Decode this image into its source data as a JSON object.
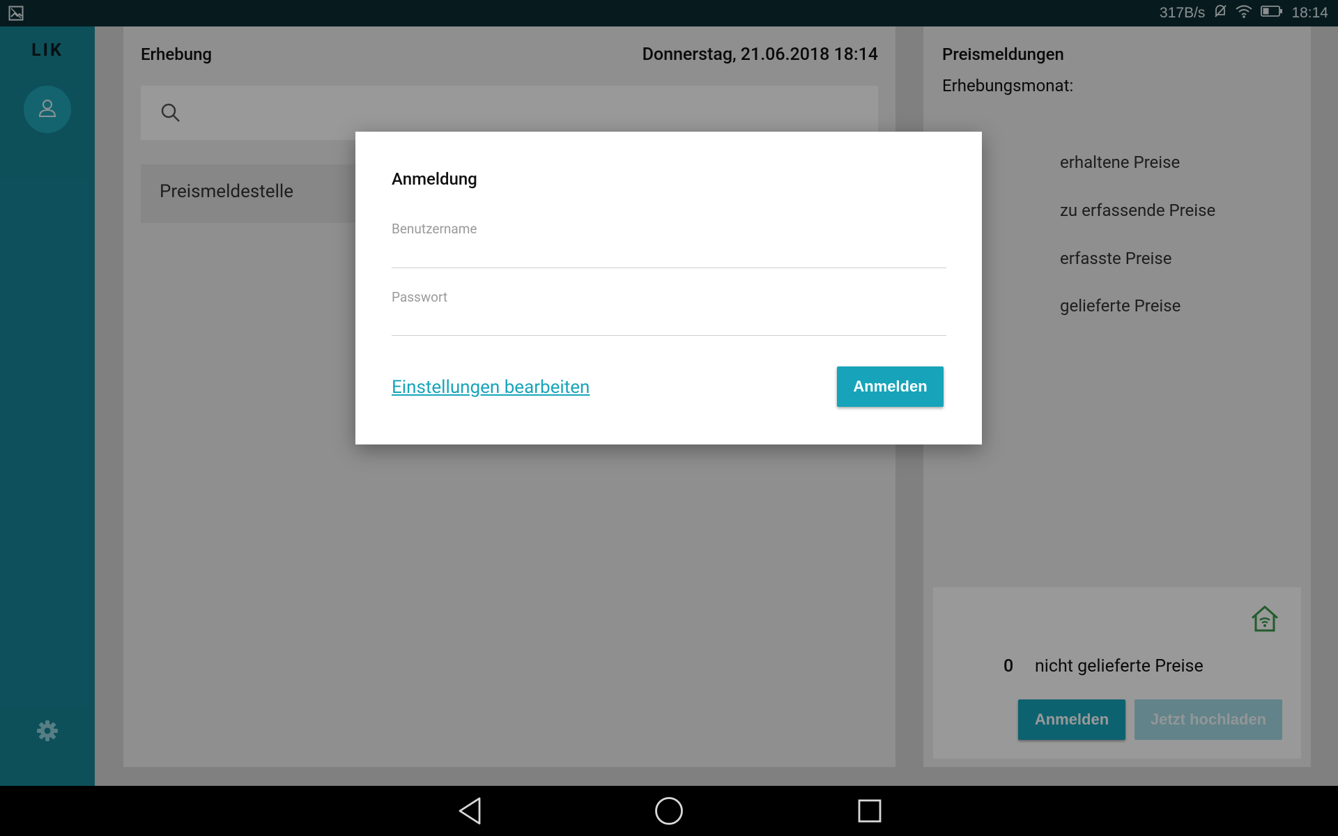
{
  "status_bar": {
    "network_speed": "317B/s",
    "time": "18:14",
    "icons": [
      "gallery-icon",
      "mute-icon",
      "wifi-icon",
      "battery-icon"
    ]
  },
  "sidebar": {
    "logo": "LIK",
    "icons": [
      "user-icon",
      "gear-icon"
    ]
  },
  "erhebung": {
    "title": "Erhebung",
    "datetime": "Donnerstag, 21.06.2018 18:14",
    "search_value": "",
    "list_item": "Preismeldestelle"
  },
  "preismeldungen": {
    "title": "Preismeldungen",
    "month_label": "Erhebungsmonat:",
    "stats": [
      "erhaltene Preise",
      "zu erfassende Preise",
      "erfasste Preise",
      "gelieferte Preise"
    ],
    "not_delivered_count": "0",
    "not_delivered_label": "nicht gelieferte Preise",
    "login_button": "Anmelden",
    "upload_button": "Jetzt hochladen",
    "home_icon": "home-wifi-icon"
  },
  "dialog": {
    "title": "Anmeldung",
    "username_label": "Benutzername",
    "username_value": "",
    "password_label": "Passwort",
    "password_value": "",
    "settings_link": "Einstellungen bearbeiten",
    "login_button": "Anmelden"
  },
  "nav_bar": [
    "back-icon",
    "home-icon",
    "recents-icon"
  ],
  "colors": {
    "sidebar": "#178697",
    "accent": "#17a4ba",
    "status_bar": "#0d2e35",
    "home_icon": "#3a9a4a"
  }
}
